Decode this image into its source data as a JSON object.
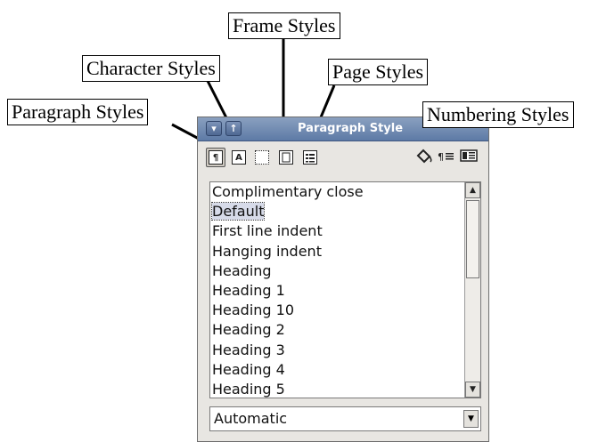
{
  "callouts": {
    "frame_styles": "Frame Styles",
    "character_styles": "Character Styles",
    "page_styles": "Page Styles",
    "paragraph_styles": "Paragraph Styles",
    "numbering_styles": "Numbering Styles"
  },
  "panel": {
    "title": "Paragraph Style",
    "title_buttons": [
      "▾",
      "↑"
    ]
  },
  "toolbar": {
    "paragraph_glyph": "¶",
    "character_glyph": "A",
    "fill_format_icon": "fill-format-icon",
    "new_style_icon": "new-style-icon",
    "update_style_icon": "update-style-icon"
  },
  "styles_list": {
    "items": [
      "Complimentary close",
      "Default",
      "First line indent",
      "Hanging indent",
      "Heading",
      "Heading 1",
      "Heading 10",
      "Heading 2",
      "Heading 3",
      "Heading 4",
      "Heading 5"
    ],
    "selected_index": 1
  },
  "filter": {
    "value": "Automatic"
  },
  "colors": {
    "titlebar": "#5d7aa6",
    "panel": "#e8e6e2",
    "selection": "#d7dbe9"
  }
}
